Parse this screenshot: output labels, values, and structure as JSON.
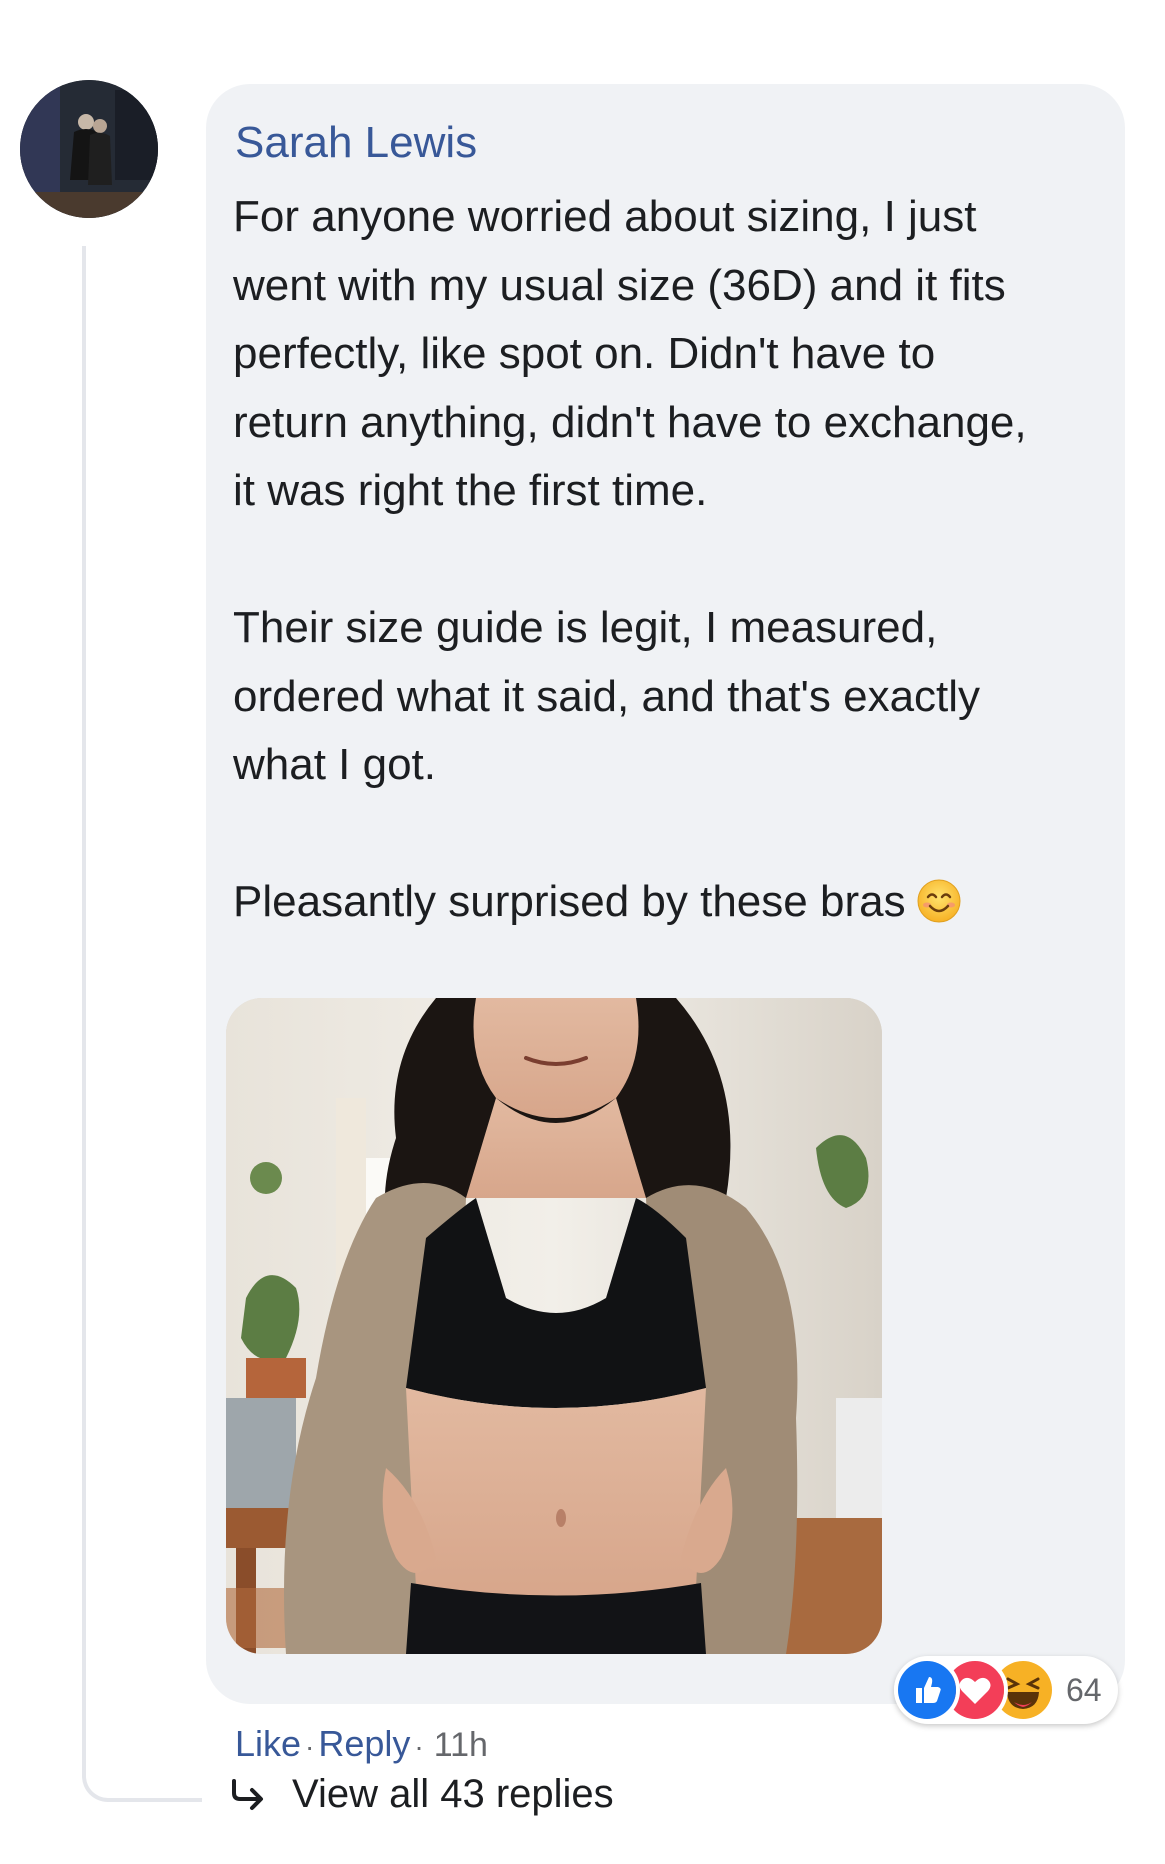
{
  "comment": {
    "author": "Sarah Lewis",
    "paragraphs": [
      "For anyone worried about sizing, I just\nwent with my usual size (36D) and it fits\nperfectly, like spot on. Didn't have to\nreturn anything, didn't have to exchange,\nit was right the first time.",
      "Their size guide is legit, I measured,\nordered what it said, and that's exactly\nwhat I got.",
      "Pleasantly surprised by these bras"
    ],
    "inline_emoji": "smiling-face-icon",
    "attachment_icon": "photo-attachment"
  },
  "reactions": {
    "icons": [
      "like-icon",
      "love-icon",
      "haha-icon"
    ],
    "count": "64",
    "colors": {
      "like": "#1877f2",
      "love": "#f33e58",
      "haha": "#f7b125"
    }
  },
  "actions": {
    "like_label": "Like",
    "reply_label": "Reply",
    "separator": "·",
    "timestamp": "11h"
  },
  "replies": {
    "label": "View all 43 replies",
    "icon": "reply-arrow-icon"
  },
  "colors": {
    "link": "#385898",
    "text": "#1c1e21",
    "bubble": "#f0f2f5",
    "muted": "#65676b"
  }
}
